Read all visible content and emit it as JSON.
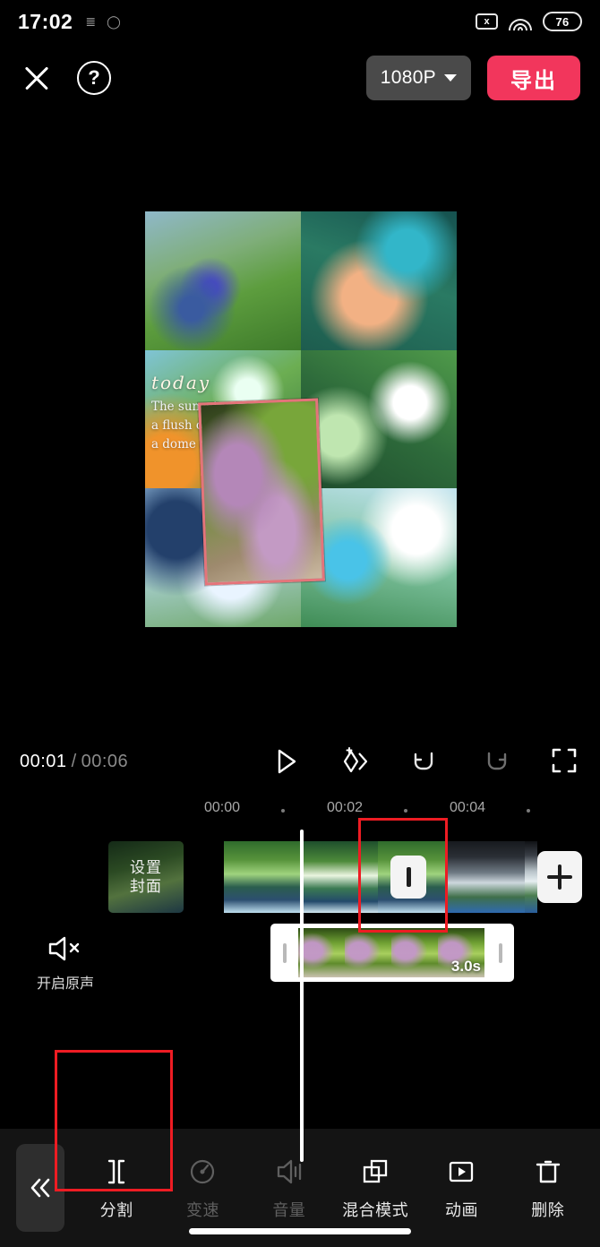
{
  "status_bar": {
    "time": "17:02",
    "icons": [
      "notification-icon",
      "alarm-icon"
    ],
    "no_sim_label": "x",
    "battery_level": "76"
  },
  "top_bar": {
    "close_icon": "close-icon",
    "help_icon": "help-icon",
    "resolution_label": "1080P",
    "export_label": "导出"
  },
  "preview": {
    "overlay_text": {
      "script": "today",
      "line1": "The sunset was mere",
      "line2": "a flush of rose on",
      "line3": "a dome of silver."
    }
  },
  "playback": {
    "current_time": "00:01",
    "separator": "/",
    "total_time": "00:06",
    "controls": [
      "play-icon",
      "keyframe-icon",
      "undo-icon",
      "redo-icon",
      "fullscreen-icon"
    ]
  },
  "timeline": {
    "ruler_ticks": [
      "00:00",
      "00:02",
      "00:04"
    ],
    "audio_tool": {
      "icon": "mute-icon",
      "label": "开启原声"
    },
    "cover": {
      "line1": "设置",
      "line2": "封面"
    },
    "transition_button": "transition-icon",
    "add_clip_button": "add-icon",
    "selected_clip_duration": "3.0s"
  },
  "bottom_toolbar": {
    "collapse_icon": "chevron-left-double-icon",
    "tools": [
      {
        "label": "分割",
        "icon": "split-icon",
        "enabled": true
      },
      {
        "label": "变速",
        "icon": "speed-icon",
        "enabled": false
      },
      {
        "label": "音量",
        "icon": "volume-icon",
        "enabled": false
      },
      {
        "label": "混合模式",
        "icon": "blend-icon",
        "enabled": true
      },
      {
        "label": "动画",
        "icon": "animation-icon",
        "enabled": true
      },
      {
        "label": "删除",
        "icon": "trash-icon",
        "enabled": true
      }
    ]
  },
  "colors": {
    "accent_red": "#f2365c",
    "annotation_red": "#ee1c23",
    "background": "#000000",
    "toolbar_bg": "#141414"
  }
}
